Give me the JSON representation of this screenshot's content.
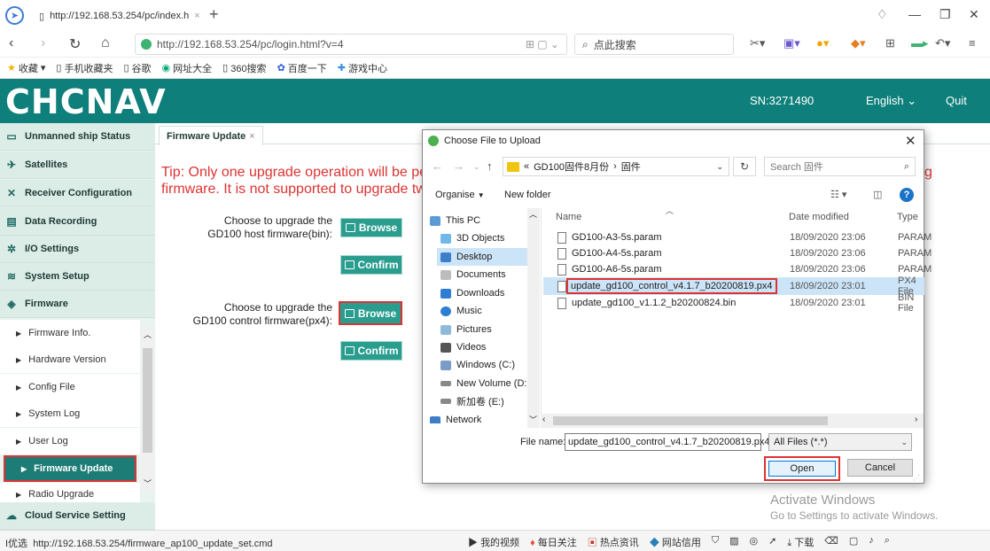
{
  "browser": {
    "tab_title": "http://192.168.53.254/pc/index.h",
    "new_tab": "+",
    "address": "http://192.168.53.254/pc/login.html?v=4",
    "search_placeholder": "点此搜索",
    "bookmarks": [
      "收藏",
      "手机收藏夹",
      "谷歌",
      "网址大全",
      "360搜索",
      "百度一下",
      "游戏中心"
    ]
  },
  "header": {
    "logo": "CHCNAV",
    "sn": "SN:3271490",
    "language": "English",
    "quit": "Quit"
  },
  "sidebar": {
    "items": [
      {
        "label": "Unmanned ship Status"
      },
      {
        "label": "Satellites"
      },
      {
        "label": "Receiver Configuration"
      },
      {
        "label": "Data Recording"
      },
      {
        "label": "I/O Settings"
      },
      {
        "label": "System Setup"
      },
      {
        "label": "Firmware"
      }
    ],
    "subitems": [
      {
        "label": "Firmware Info."
      },
      {
        "label": "Hardware Version"
      },
      {
        "label": "Config File"
      },
      {
        "label": "System Log"
      },
      {
        "label": "User Log"
      },
      {
        "label": "Firmware Update"
      },
      {
        "label": "Radio Upgrade"
      }
    ],
    "bottom_item": "Cloud Service Setting"
  },
  "main": {
    "tab_label": "Firmware Update",
    "tab_close": "×",
    "tip_line1": "Tip: Only one upgrade operation will be pe",
    "tip_line2": "firmware. It is not supported to upgrade tw",
    "tip_right": "g",
    "host_label_1": "Choose to upgrade the",
    "host_label_2": "GD100 host firmware(bin):",
    "control_label_1": "Choose to upgrade the",
    "control_label_2": "GD100 control firmware(px4):",
    "browse": "Browse",
    "confirm": "Confirm"
  },
  "dialog": {
    "title": "Choose File to Upload",
    "breadcrumb_prefix": "«",
    "breadcrumb": [
      "GD100固件8月份",
      "固件"
    ],
    "search_placeholder": "Search 固件",
    "organise": "Organise",
    "new_folder": "New folder",
    "nav_items": [
      "This PC",
      "3D Objects",
      "Desktop",
      "Documents",
      "Downloads",
      "Music",
      "Pictures",
      "Videos",
      "Windows (C:)",
      "New Volume (D:",
      "新加卷 (E:)",
      "Network"
    ],
    "columns": {
      "name": "Name",
      "date": "Date modified",
      "type": "Type"
    },
    "files": [
      {
        "name": "GD100-A3-5s.param",
        "date": "18/09/2020 23:06",
        "type": "PARAM"
      },
      {
        "name": "GD100-A4-5s.param",
        "date": "18/09/2020 23:06",
        "type": "PARAM"
      },
      {
        "name": "GD100-A6-5s.param",
        "date": "18/09/2020 23:06",
        "type": "PARAM"
      },
      {
        "name": "update_gd100_control_v4.1.7_b20200819.px4",
        "date": "18/09/2020 23:01",
        "type": "PX4 File"
      },
      {
        "name": "update_gd100_v1.1.2_b20200824.bin",
        "date": "18/09/2020 23:01",
        "type": "BIN File"
      }
    ],
    "file_name_label": "File name:",
    "file_name_value": "update_gd100_control_v4.1.7_b20200819.px4",
    "filter": "All Files (*.*)",
    "open": "Open",
    "cancel": "Cancel"
  },
  "activate": {
    "line1": "Activate Windows",
    "line2": "Go to Settings to activate Windows."
  },
  "status": {
    "url_prefix": "I优选",
    "url": "http://192.168.53.254/firmware_ap100_update_set.cmd",
    "items": [
      "我的视频",
      "每日关注",
      "热点资讯",
      "网站信用",
      "下载"
    ]
  },
  "colors": {
    "brand": "#0e7f7a",
    "highlight": "#dd3333",
    "button": "#2a9d8f"
  }
}
